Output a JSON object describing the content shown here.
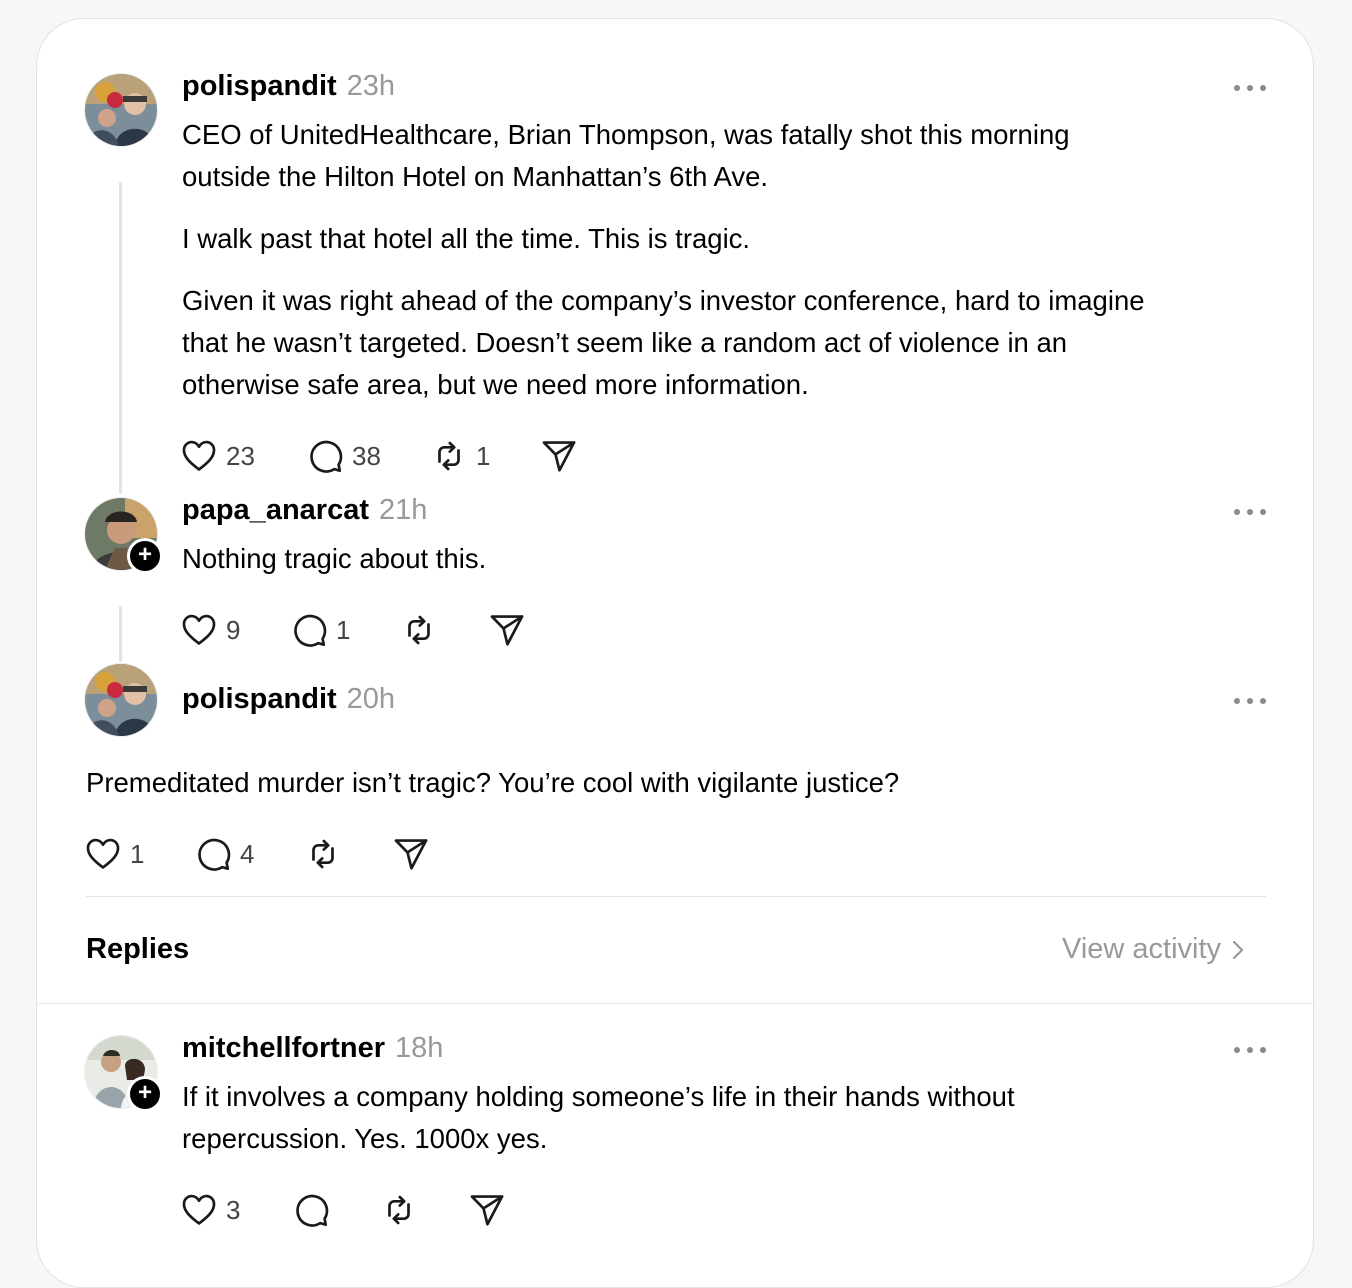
{
  "posts": [
    {
      "username": "polispandit",
      "time": "23h",
      "paragraphs": [
        "CEO of UnitedHealthcare, Brian Thompson, was fatally shot this morning",
        "outside the Hilton Hotel on Manhattan’s 6th Ave.",
        "I walk past that hotel all the time. This is tragic.",
        "Given it was right ahead of the company’s investor conference, hard to imagine",
        "that he wasn’t targeted. Doesn’t seem like a random act of violence in an",
        "otherwise safe area, but we need more information."
      ],
      "likes": "23",
      "comments": "38",
      "reposts": "1"
    },
    {
      "username": "papa_anarcat",
      "time": "21h",
      "paragraphs": [
        "Nothing tragic about this."
      ],
      "likes": "9",
      "comments": "1",
      "reposts": ""
    },
    {
      "username": "polispandit",
      "time": "20h",
      "paragraphs": [
        "Premeditated murder isn’t tragic? You’re cool with vigilante justice?"
      ],
      "likes": "1",
      "comments": "4",
      "reposts": ""
    }
  ],
  "replies_section": {
    "title": "Replies",
    "view_activity": "View activity"
  },
  "replies": [
    {
      "username": "mitchellfortner",
      "time": "18h",
      "paragraphs": [
        "If it involves a company holding someone’s life in their hands without",
        "repercussion. Yes. 1000x yes."
      ],
      "likes": "3",
      "comments": "",
      "reposts": ""
    }
  ],
  "icons": {
    "like": "heart-icon",
    "comment": "comment-bubble-icon",
    "repost": "repost-icon",
    "share": "send-icon",
    "more": "more-horizontal-icon",
    "follow": "plus-icon",
    "chevron": "chevron-right-icon"
  },
  "colors": {
    "background": "#f7f7f7",
    "card": "#ffffff",
    "secondary_text": "#999999",
    "divider": "#e5e5e5"
  }
}
